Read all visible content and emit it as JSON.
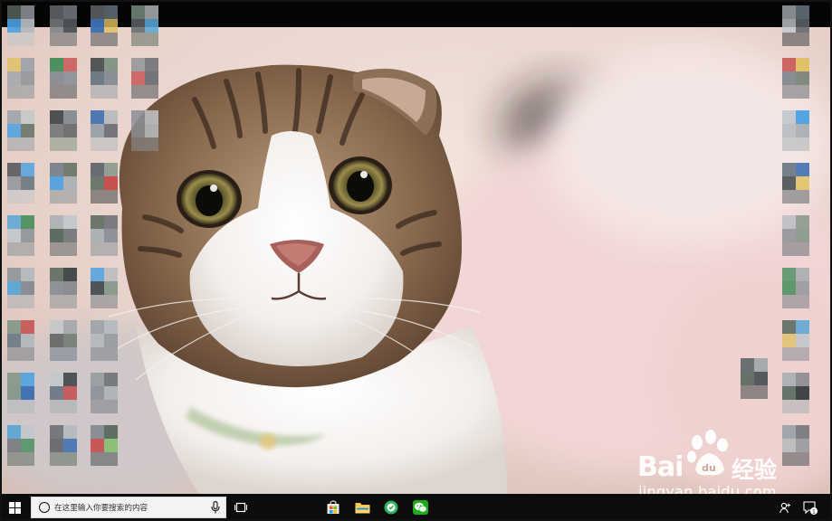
{
  "taskbar": {
    "search_placeholder": "在这里输入你要搜索的内容",
    "notification_count": "1",
    "pinned_apps": [
      {
        "name": "microsoft-store",
        "running": false
      },
      {
        "name": "file-explorer",
        "running": false
      },
      {
        "name": "browser",
        "running": true
      },
      {
        "name": "wechat",
        "running": true
      }
    ]
  },
  "watermark": {
    "logo_text": "Bai",
    "logo_du": "du",
    "cn_text": "经验",
    "domain": "jingyan.baidu.com"
  },
  "colors": {
    "taskbar_bg": "#0c0c0c",
    "accent_running": "#6ab0ff",
    "wechat_green": "#1aad19"
  }
}
